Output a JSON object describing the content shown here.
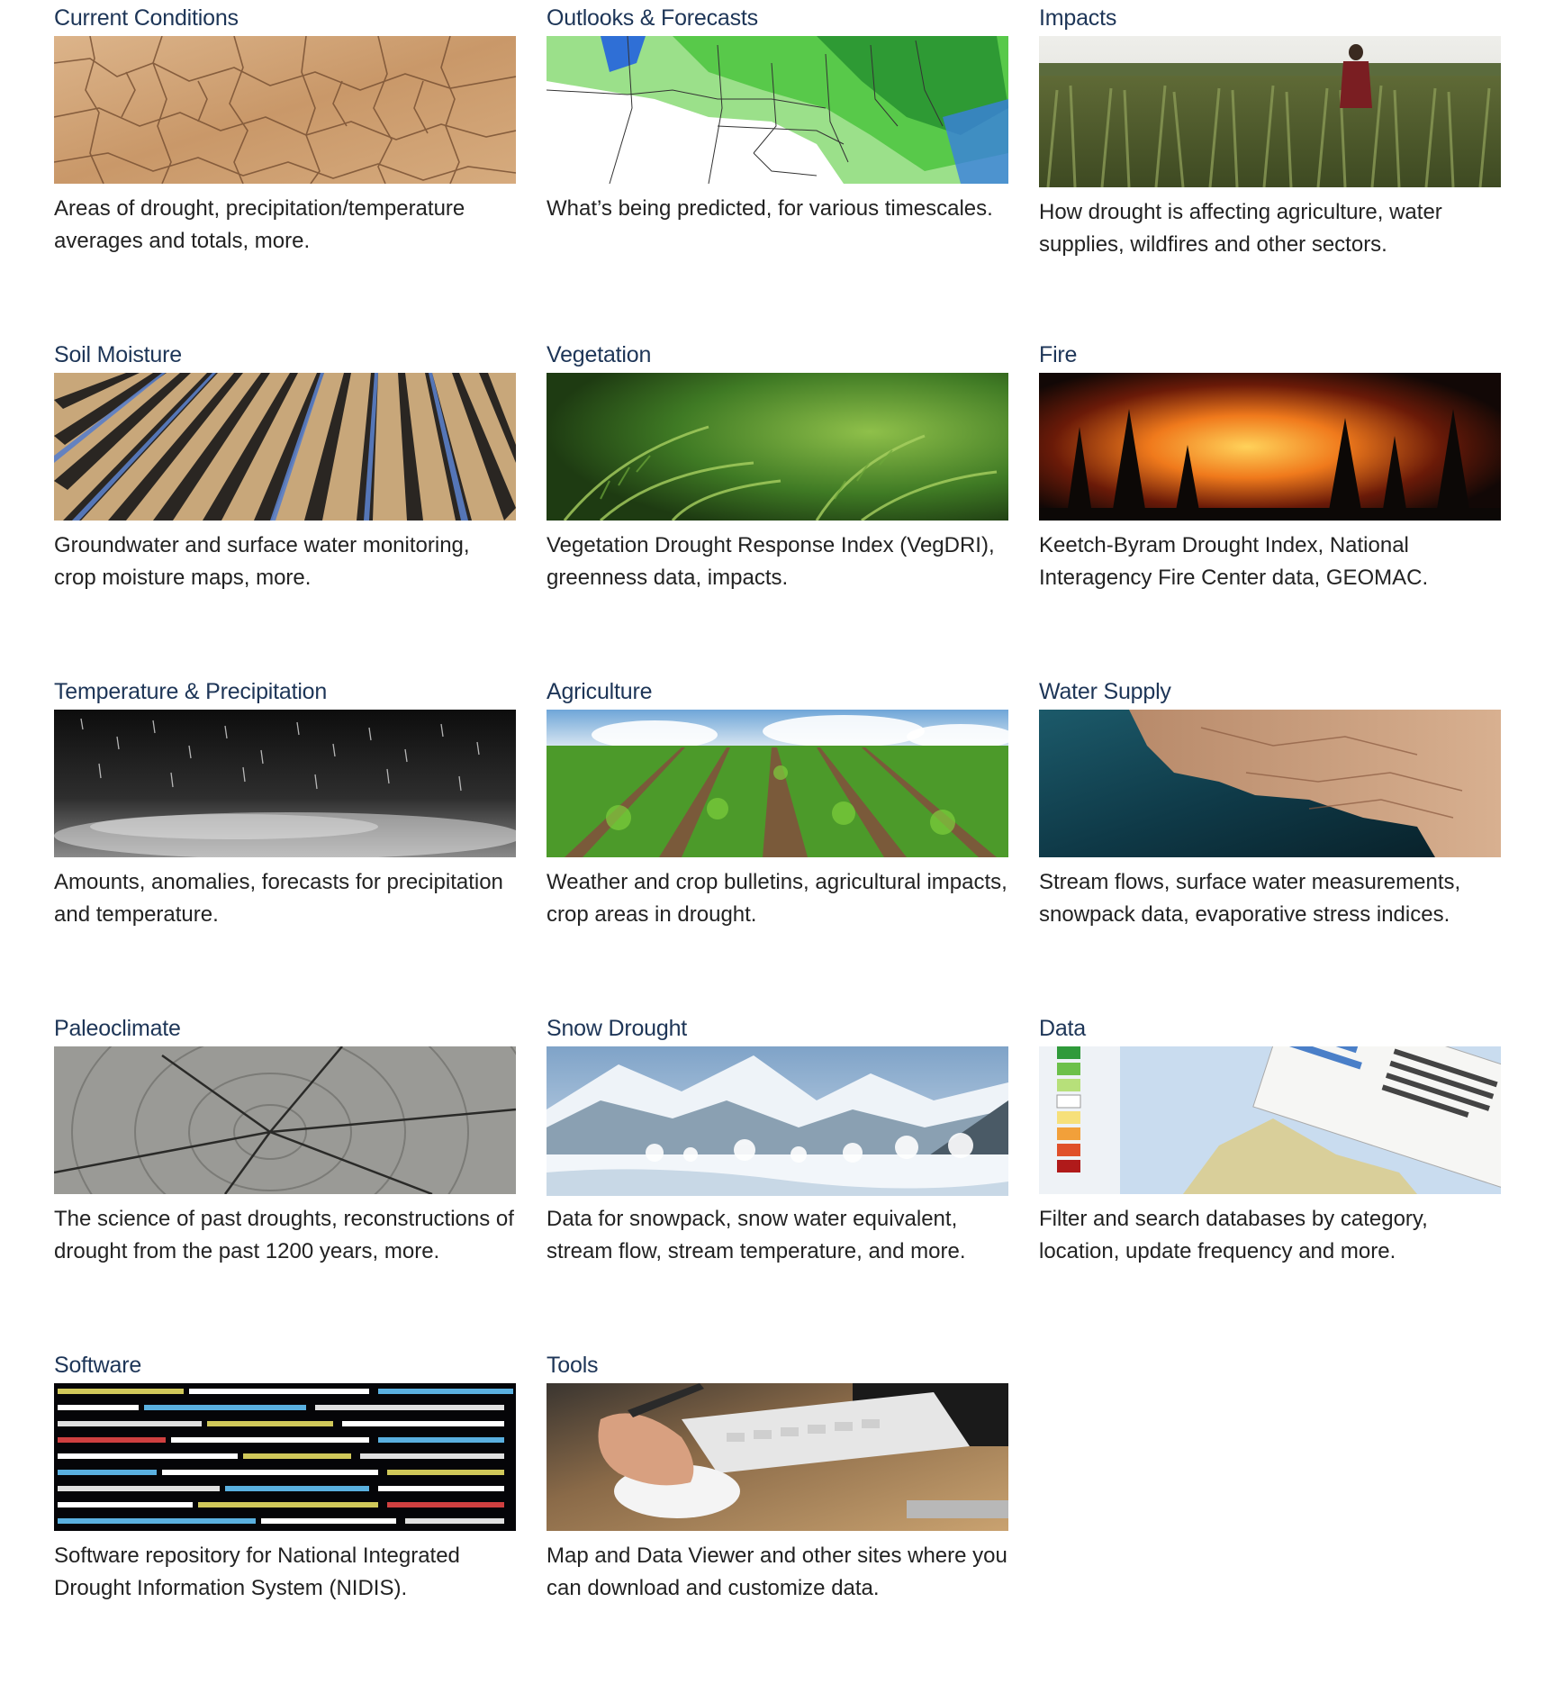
{
  "cards": [
    {
      "title": "Current Conditions",
      "description": "Areas of drought, precipitation/temperature averages and totals, more.",
      "image": "cracked-earth-image"
    },
    {
      "title": "Outlooks & Forecasts",
      "description": "What’s being predicted, for various timescales.",
      "image": "forecast-map-image"
    },
    {
      "title": "Impacts",
      "description": "How drought is affecting agriculture, water supplies, wildfires and other sectors.",
      "image": "cornfield-person-image"
    },
    {
      "title": "Soil Moisture",
      "description": "Groundwater and surface water monitoring, crop moisture maps, more.",
      "image": "irrigated-furrows-image"
    },
    {
      "title": "Vegetation",
      "description": "Vegetation Drought Response Index (VegDRI), greenness data, impacts.",
      "image": "fern-forest-image"
    },
    {
      "title": "Fire",
      "description": "Keetch-Byram Drought Index, National Interagency Fire Center data, GEOMAC.",
      "image": "wildfire-image"
    },
    {
      "title": "Temperature & Precipitation",
      "description": "Amounts, anomalies, forecasts for precipitation and temperature.",
      "image": "rain-image"
    },
    {
      "title": "Agriculture",
      "description": "Weather and crop bulletins, agricultural impacts, crop areas in drought.",
      "image": "crop-rows-image"
    },
    {
      "title": "Water Supply",
      "description": "Stream flows, surface water measurements, snowpack data, evaporative stress indices.",
      "image": "reservoir-aerial-image"
    },
    {
      "title": "Paleoclimate",
      "description": "The science of past droughts, reconstructions of drought from the past 1200 years, more.",
      "image": "tree-rings-image"
    },
    {
      "title": "Snow Drought",
      "description": "Data for snowpack, snow water equivalent, stream flow, stream temperature, and more.",
      "image": "snowy-mountains-image"
    },
    {
      "title": "Data",
      "description": "Filter and search databases by category, location, update frequency and more.",
      "image": "data-map-screenshot-image"
    },
    {
      "title": "Software",
      "description": "Software repository for National Integrated Drought Information System (NIDIS).",
      "image": "source-code-image"
    },
    {
      "title": "Tools",
      "description": "Map and Data Viewer and other sites where you can download and customize data.",
      "image": "mouse-keyboard-image"
    }
  ],
  "colors": {
    "title": "#1d3557",
    "body_text": "#222222",
    "background": "#ffffff"
  }
}
